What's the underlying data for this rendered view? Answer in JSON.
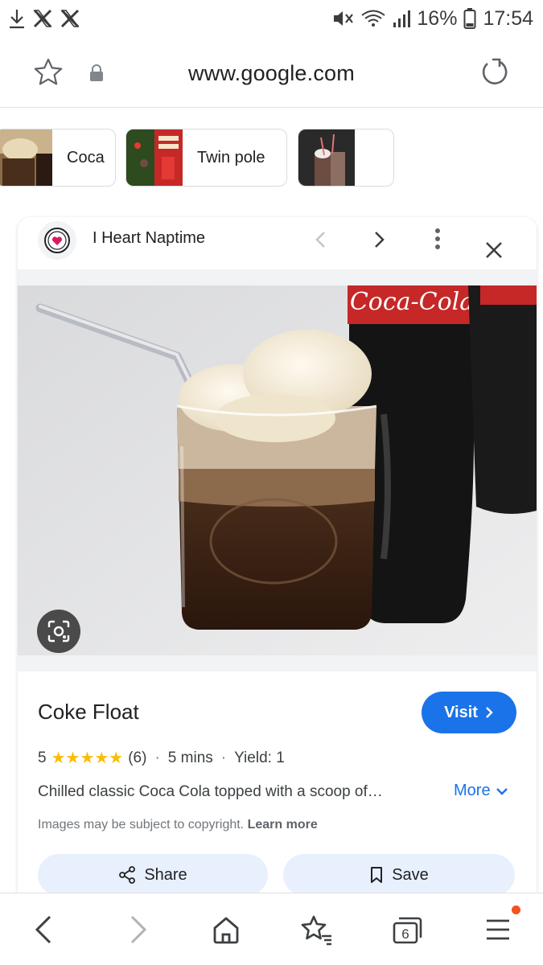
{
  "status_bar": {
    "battery": "16%",
    "time": "17:54"
  },
  "browser": {
    "url": "www.google.com"
  },
  "chips": [
    {
      "label": "Coca"
    },
    {
      "label": "Twin pole"
    },
    {
      "label": ""
    }
  ],
  "panel": {
    "source_name": "I Heart Naptime",
    "title": "Coke Float",
    "visit_label": "Visit",
    "rating": "5",
    "stars": "★★★★★",
    "review_count": "(6)",
    "time": "5 mins",
    "yield": "Yield: 1",
    "description": "Chilled classic Coca Cola topped with a scoop of…",
    "more_label": "More",
    "copyright_text": "Images may be subject to copyright.",
    "learn_more": "Learn more",
    "share_label": "Share",
    "save_label": "Save",
    "image_text": {
      "bottle_brand": "Coca-Cola"
    }
  },
  "bottom_nav": {
    "tab_count": "6"
  },
  "colors": {
    "accent": "#1a73e8",
    "star": "#fbbc04",
    "pill_bg": "#e8f0fe",
    "badge": "#f4511e"
  }
}
